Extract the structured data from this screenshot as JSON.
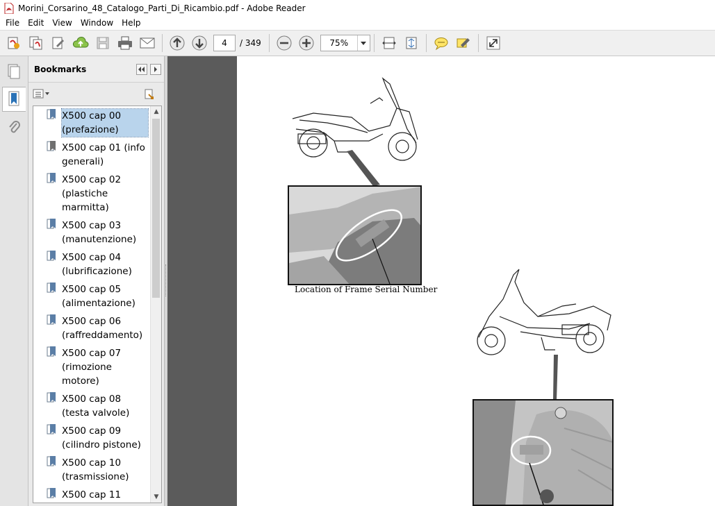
{
  "window": {
    "title": "Morini_Corsarino_48_Catalogo_Parti_Di_Ricambio.pdf - Adobe Reader"
  },
  "menu": [
    "File",
    "Edit",
    "View",
    "Window",
    "Help"
  ],
  "toolbar": {
    "current_page": "4",
    "total_pages": "/ 349",
    "zoom": "75%"
  },
  "bookmarks": {
    "title": "Bookmarks",
    "items": [
      "X500 cap 00 (prefazione)",
      "X500 cap 01 (info generali)",
      "X500 cap 02 (plastiche marmitta)",
      "X500 cap 03 (manutenzione)",
      "X500 cap 04 (lubrificazione)",
      "X500 cap 05 (alimentazione)",
      "X500 cap 06 (raffreddamento)",
      "X500 cap 07 (rimozione motore)",
      "X500 cap 08 (testa valvole)",
      "X500 cap 09 (cilindro pistone)",
      "X500 cap 10 (trasmissione)",
      "X500 cap 11"
    ]
  },
  "document": {
    "caption_frame": "Location of Frame Serial Number"
  },
  "colors": {
    "toolbar_bg": "#f0f0f0",
    "doc_bg": "#5b5b5b",
    "selection": "#b9d4ec"
  }
}
